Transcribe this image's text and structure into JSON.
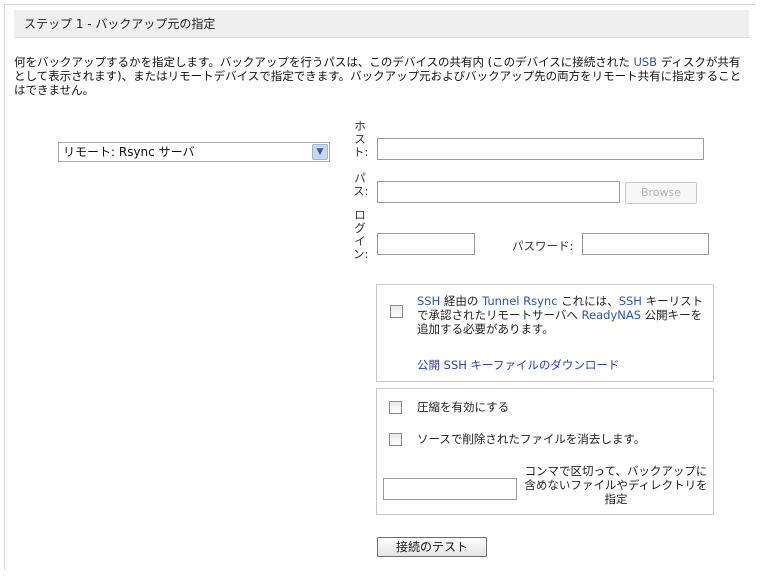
{
  "header": {
    "title": "ステップ 1 - バックアップ元の指定"
  },
  "description": {
    "part1": "何をバックアップするかを指定します。バックアップを行うパスは、このデバイスの共有内 (このデバイスに接続された ",
    "usb": "USB",
    "part2": " ディスクが共有として表示されます)、またはリモートデバイスで指定できます。バックアップ元およびバックアップ先の両方をリモート共有に指定することはできません。"
  },
  "source": {
    "selected_option": "リモート: Rsync サーバ"
  },
  "labels": {
    "host": "ホスト:",
    "path": "パス:",
    "login": "ログイン:",
    "password": "パスワード:"
  },
  "fields": {
    "host_value": "",
    "path_value": "",
    "login_value": "",
    "password_value": "",
    "exclude_value": ""
  },
  "browse_label": "Browse",
  "ssh_panel": {
    "text_ssh1": "SSH",
    "text_a": " 経由の ",
    "text_tunnel": "Tunnel Rsync",
    "text_b": " これには、",
    "text_ssh2": "SSH",
    "text_c": " キーリストで承認されたリモートサーバへ ",
    "text_readynas": "ReadyNAS",
    "text_d": " 公開キーを追加する必要があります。",
    "download_link": "公開 SSH キーファイルのダウンロード",
    "checked": false
  },
  "options_panel": {
    "compression_label": "圧縮を有効にする",
    "compression_checked": false,
    "delete_label": "ソースで削除されたファイルを消去します。",
    "delete_checked": false,
    "exclude_label": "コンマで区切って、バックアップに含めないファイルやディレクトリを指定"
  },
  "test_button_label": "接続のテスト",
  "colors": {
    "header_bg": "#efefef",
    "link_blue": "#2a3fb8",
    "highlight_blue": "#2a55b8"
  }
}
